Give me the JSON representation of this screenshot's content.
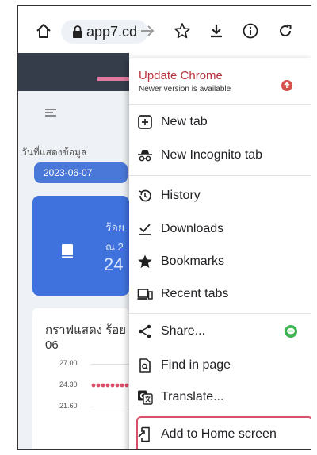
{
  "browser": {
    "url_text": "app7.cd",
    "toolbar_icons": [
      "home-icon",
      "lock-icon",
      "forward-icon",
      "bookmark-star-icon",
      "download-icon",
      "info-icon",
      "reload-icon"
    ]
  },
  "page": {
    "date_label": "วันที่แสดงข้อมูล",
    "date_value": "2023-06-07",
    "card_line1": "ร้อย",
    "card_line2": "ณ 2",
    "card_value": "24",
    "chart_title": "กราฟแสดง ร้อย 06",
    "chart_data": {
      "type": "scatter",
      "title": "กราฟแสดง ร้อย 06",
      "y_ticks": [
        "27.00",
        "24.30",
        "21.60"
      ],
      "ylim": [
        21.6,
        27.0
      ],
      "points_visible_near": "24.30"
    }
  },
  "menu": {
    "update": {
      "title": "Update Chrome",
      "subtitle": "Newer version is available",
      "badge_color": "#d6534f"
    },
    "items": [
      {
        "label": "New tab",
        "icon": "plus-box-icon"
      },
      {
        "label": "New Incognito tab",
        "icon": "incognito-icon"
      },
      {
        "label": "History",
        "icon": "history-icon"
      },
      {
        "label": "Downloads",
        "icon": "downloads-icon"
      },
      {
        "label": "Bookmarks",
        "icon": "star-icon"
      },
      {
        "label": "Recent tabs",
        "icon": "devices-icon"
      },
      {
        "label": "Share...",
        "icon": "share-icon"
      },
      {
        "label": "Find in page",
        "icon": "find-in-page-icon"
      },
      {
        "label": "Translate...",
        "icon": "translate-icon"
      },
      {
        "label": "Add to Home screen",
        "icon": "add-to-home-icon"
      }
    ],
    "highlight_color": "#d9506a",
    "accent_color": "#b8323a"
  }
}
